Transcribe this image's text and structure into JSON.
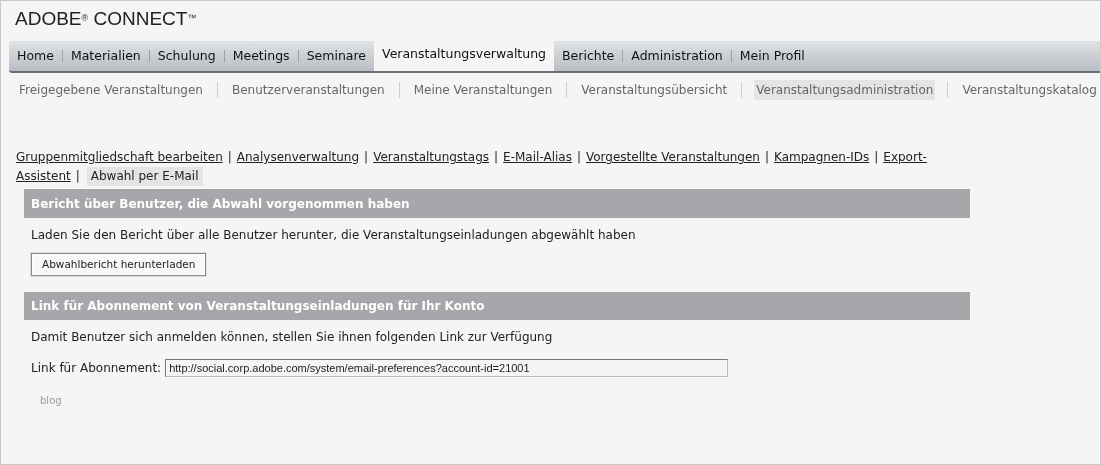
{
  "logo": "ADOBE$^{®}$ CONNECT$^{™}$",
  "tabs": [
    {
      "label": "Home",
      "selected": false
    },
    {
      "label": "Materialien",
      "selected": false
    },
    {
      "label": "Schulung",
      "selected": false
    },
    {
      "label": "Meetings",
      "selected": false
    },
    {
      "label": "Seminare",
      "selected": false
    },
    {
      "label": "Veranstaltungsverwaltung",
      "selected": true
    },
    {
      "label": "Berichte",
      "selected": false
    },
    {
      "label": "Administration",
      "selected": false
    },
    {
      "label": "Mein Profil",
      "selected": false
    }
  ],
  "subnav": [
    {
      "label": "Freigegebene Veranstaltungen",
      "selected": false
    },
    {
      "label": "Benutzerveranstaltungen",
      "selected": false
    },
    {
      "label": "Meine Veranstaltungen",
      "selected": false
    },
    {
      "label": "Veranstaltungsübersicht",
      "selected": false
    },
    {
      "label": "Veranstaltungsadministration",
      "selected": true
    },
    {
      "label": "Veranstaltungskatalog",
      "selected": false
    }
  ],
  "link_lines": [
    [
      {
        "label": "Gruppenmitgliedschaft bearbeiten",
        "selected": false
      },
      {
        "separator": "|",
        "label": "Analysenverwaltung",
        "selected": false
      },
      {
        "separator": "|",
        "label": "Veranstaltungstags",
        "selected": false
      },
      {
        "separator": "|",
        "label": "E-Mail-Alias",
        "selected": false
      },
      {
        "separator": "|",
        "label": "Vorgestellte Veranstaltungen",
        "selected": false
      },
      {
        "separator": "|",
        "label": "Kampagnen-IDs",
        "selected": false
      },
      {
        "separator": "|",
        "label": "Export-",
        "selected": false
      }
    ],
    [
      {
        "label": "Assistent",
        "selected": false
      },
      {
        "separator": "|",
        "label": "Abwahl per E-Mail",
        "selected": true
      }
    ]
  ],
  "report_section": {
    "title": "Bericht über Benutzer, die Abwahl vorgenommen haben",
    "text": "Laden Sie den Bericht über alle Benutzer herunter, die Veranstaltungseinladungen abgewählt haben",
    "button": "Abwahlbericht herunterladen"
  },
  "subscription_section": {
    "title": "Link für Abonnement von Veranstaltungseinladungen für Ihr Konto",
    "text": "Damit Benutzer sich anmelden können, stellen Sie ihnen folgenden Link zur Verfügung",
    "field_label": "Link für Abonnement:",
    "field_value": "http://social.corp.adobe.com/system/email-preferences?account-id=21001"
  },
  "footer_link": "blog"
}
